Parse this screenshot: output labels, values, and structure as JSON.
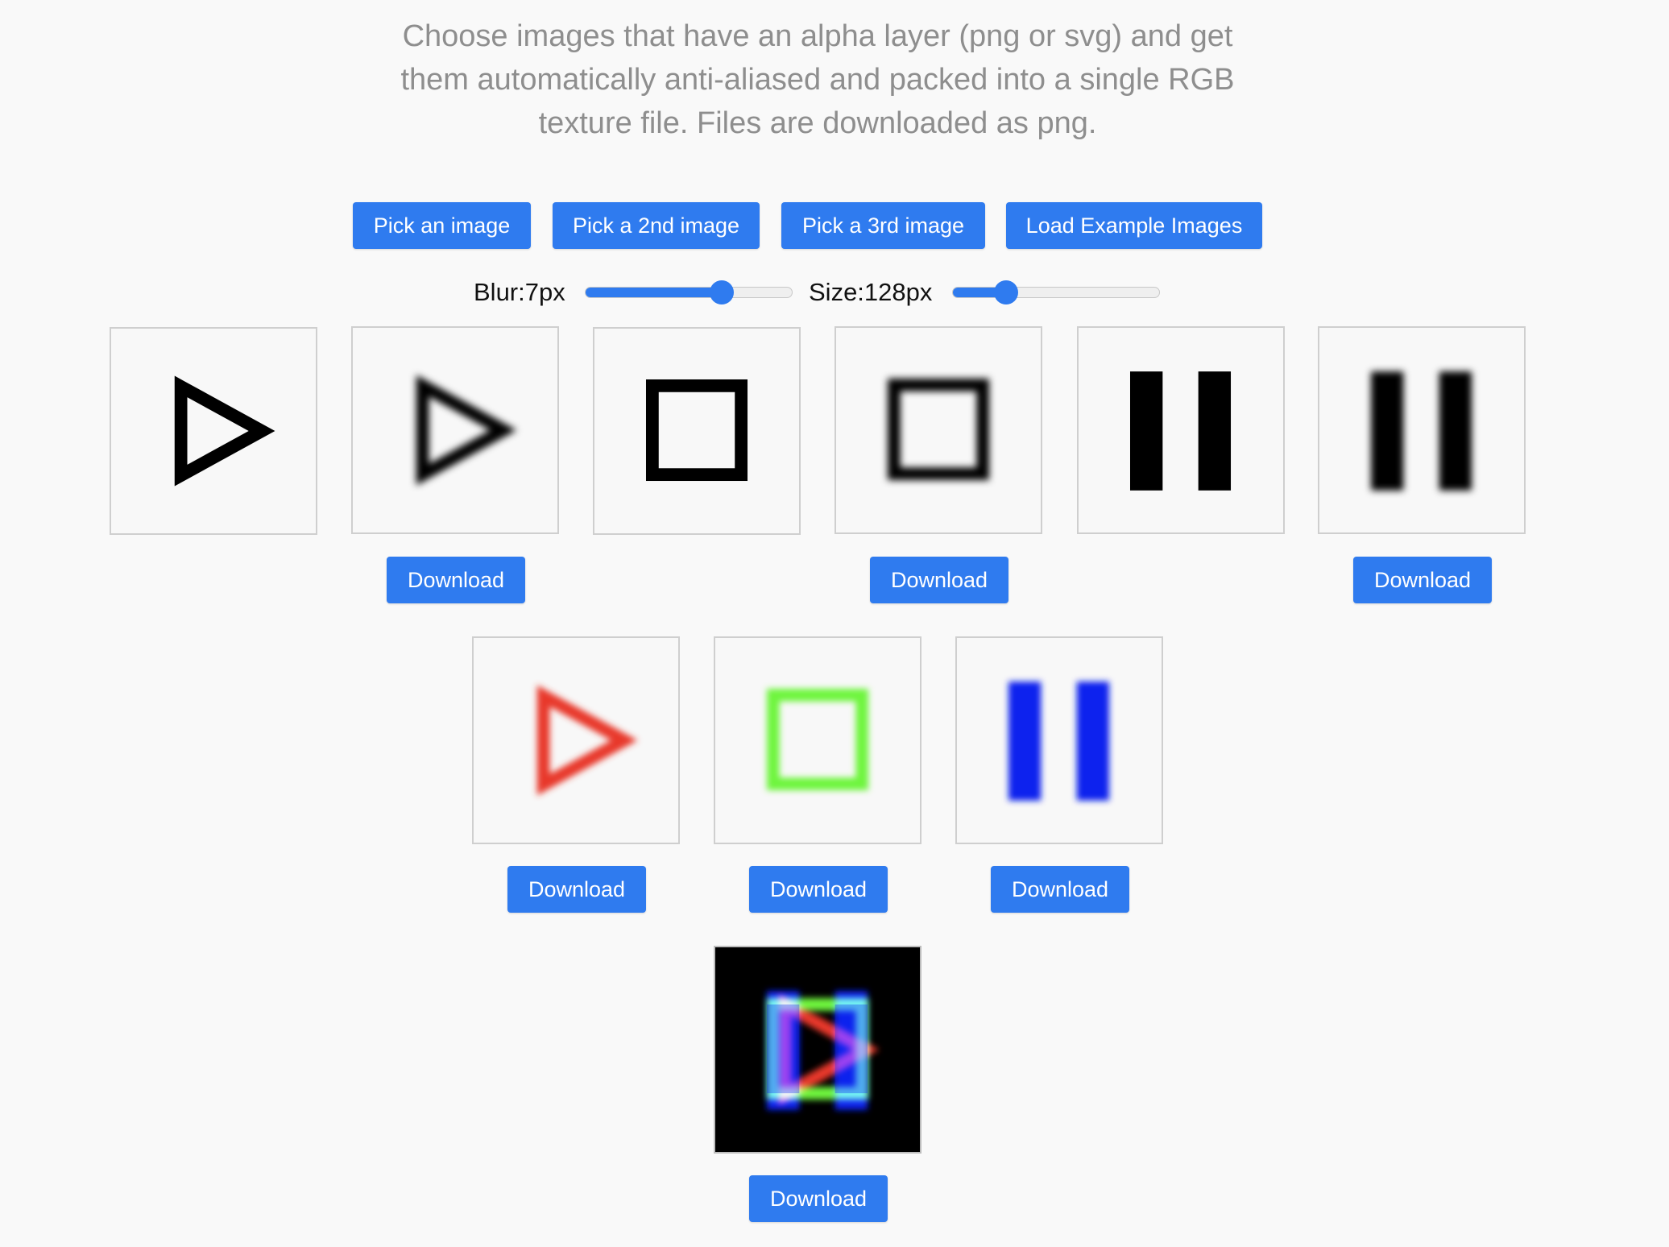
{
  "intro": {
    "text": "Choose images that have an alpha layer (png or svg) and get them automatically anti-aliased and packed into a single RGB texture file. Files are downloaded as png."
  },
  "toolbar": {
    "pick_1": "Pick an image",
    "pick_2": "Pick a 2nd image",
    "pick_3": "Pick a 3rd image",
    "load_examples": "Load Example Images"
  },
  "controls": {
    "blur_label": "Blur:7px",
    "blur_value": 0.68,
    "size_label": "Size:128px",
    "size_value": 0.23,
    "accent": "#2f7bef"
  },
  "sources": [
    {
      "icon": "play-outline-icon",
      "variant": "original"
    },
    {
      "icon": "play-outline-icon",
      "variant": "blurred"
    },
    {
      "icon": "square-outline-icon",
      "variant": "original"
    },
    {
      "icon": "square-outline-icon",
      "variant": "blurred"
    },
    {
      "icon": "pause-icon",
      "variant": "original"
    },
    {
      "icon": "pause-icon",
      "variant": "blurred"
    }
  ],
  "channels": [
    {
      "icon": "play-outline-icon",
      "channel": "red",
      "color": "#e8392a"
    },
    {
      "icon": "square-outline-icon",
      "channel": "green",
      "color": "#6ef53c"
    },
    {
      "icon": "pause-icon",
      "channel": "blue",
      "color": "#0a22ee"
    }
  ],
  "combined": {
    "icon": "packed-rgb-icon",
    "background": "#000000"
  },
  "download_label": "Download"
}
